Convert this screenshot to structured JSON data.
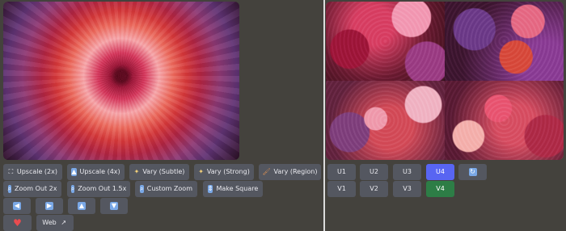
{
  "left_actions": {
    "row1": [
      "Upscale (2x)",
      "Upscale (4x)",
      "Vary (Subtle)",
      "Vary (Strong)",
      "Vary (Region)"
    ],
    "row2": [
      "Zoom Out 2x",
      "Zoom Out 1.5x",
      "Custom Zoom",
      "Make Square"
    ],
    "row4_web": "Web"
  },
  "right_actions": {
    "upscale": [
      "U1",
      "U2",
      "U3",
      "U4"
    ],
    "variation": [
      "V1",
      "V2",
      "V3",
      "V4"
    ]
  },
  "icons": {
    "upscale_2x": "grid-icon",
    "upscale_4x": "up-arrow-box-icon",
    "vary_subtle": "sparkle-icon",
    "vary_strong": "sparkle-icon",
    "vary_region": "brush-icon",
    "zoom_out_2x": "magnifier-icon",
    "zoom_out_15x": "magnifier-icon",
    "custom_zoom": "magnifier-icon",
    "make_square": "resize-icon",
    "left": "arrow-left-icon",
    "right": "arrow-right-icon",
    "up": "arrow-up-icon",
    "down": "arrow-down-icon",
    "favorite": "heart-icon",
    "web_external": "external-link-icon",
    "refresh": "refresh-icon"
  },
  "colors": {
    "background": "#44423d",
    "button": "#545760",
    "button_text": "#e9e9ee",
    "selected_upscale": "#5865f2",
    "selected_variation": "#2d7d46"
  }
}
